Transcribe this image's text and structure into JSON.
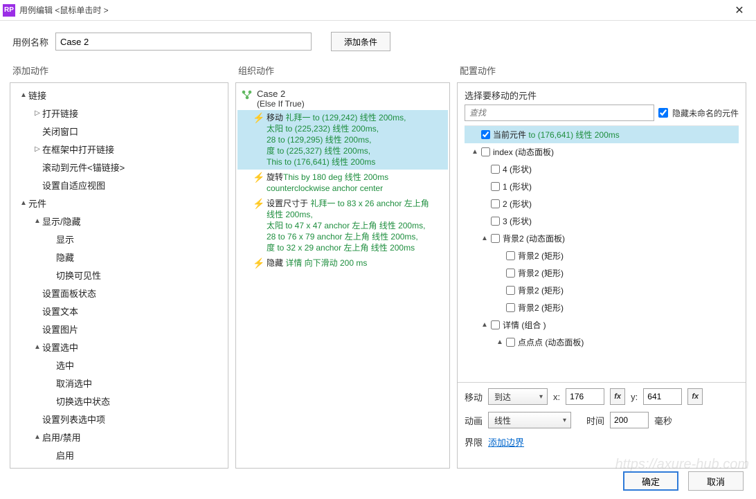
{
  "title": "用例编辑 <鼠标单击时 >",
  "case_name_label": "用例名称",
  "case_name_value": "Case 2",
  "add_condition_btn": "添加条件",
  "section_headers": {
    "add_action": "添加动作",
    "organize_action": "组织动作",
    "configure_action": "配置动作"
  },
  "left_tree": [
    {
      "indent": 1,
      "toggle": "▲",
      "label": "链接"
    },
    {
      "indent": 2,
      "toggle": "▷",
      "label": "打开链接"
    },
    {
      "indent": 2,
      "toggle": "",
      "label": "关闭窗口"
    },
    {
      "indent": 2,
      "toggle": "▷",
      "label": "在框架中打开链接"
    },
    {
      "indent": 2,
      "toggle": "",
      "label": "滚动到元件<锚链接>"
    },
    {
      "indent": 2,
      "toggle": "",
      "label": "设置自适应视图"
    },
    {
      "indent": 1,
      "toggle": "▲",
      "label": "元件"
    },
    {
      "indent": 2,
      "toggle": "▲",
      "label": "显示/隐藏"
    },
    {
      "indent": 3,
      "toggle": "",
      "label": "显示"
    },
    {
      "indent": 3,
      "toggle": "",
      "label": "隐藏"
    },
    {
      "indent": 3,
      "toggle": "",
      "label": "切换可见性"
    },
    {
      "indent": 2,
      "toggle": "",
      "label": "设置面板状态"
    },
    {
      "indent": 2,
      "toggle": "",
      "label": "设置文本"
    },
    {
      "indent": 2,
      "toggle": "",
      "label": "设置图片"
    },
    {
      "indent": 2,
      "toggle": "▲",
      "label": "设置选中"
    },
    {
      "indent": 3,
      "toggle": "",
      "label": "选中"
    },
    {
      "indent": 3,
      "toggle": "",
      "label": "取消选中"
    },
    {
      "indent": 3,
      "toggle": "",
      "label": "切换选中状态"
    },
    {
      "indent": 2,
      "toggle": "",
      "label": "设置列表选中项"
    },
    {
      "indent": 2,
      "toggle": "▲",
      "label": "启用/禁用"
    },
    {
      "indent": 3,
      "toggle": "",
      "label": "启用"
    }
  ],
  "case": {
    "title": "Case 2",
    "subtitle": "(Else If True)"
  },
  "actions": [
    {
      "selected": true,
      "lines": [
        [
          {
            "t": "移动 ",
            "c": "black"
          },
          {
            "t": "礼拜一 to (129,242) 线性 200ms,",
            "c": "green"
          }
        ],
        [
          {
            "t": "太阳 to (225,232) 线性 200ms,",
            "c": "green"
          }
        ],
        [
          {
            "t": "28 to (129,295) 线性 200ms,",
            "c": "green"
          }
        ],
        [
          {
            "t": "度 to (225,327) 线性 200ms,",
            "c": "green"
          }
        ],
        [
          {
            "t": "This to (176,641) 线性 200ms",
            "c": "green"
          }
        ]
      ]
    },
    {
      "selected": false,
      "lines": [
        [
          {
            "t": "旋转",
            "c": "black"
          },
          {
            "t": "This by 180 deg 线性 200ms",
            "c": "green"
          }
        ],
        [
          {
            "t": "counterclockwise anchor center",
            "c": "green"
          }
        ]
      ]
    },
    {
      "selected": false,
      "lines": [
        [
          {
            "t": "设置尺寸于 ",
            "c": "black"
          },
          {
            "t": "礼拜一 to 83 x 26 anchor 左上角",
            "c": "green"
          }
        ],
        [
          {
            "t": "线性 200ms,",
            "c": "green"
          }
        ],
        [
          {
            "t": "太阳 to 47 x 47 anchor 左上角 线性 200ms,",
            "c": "green"
          }
        ],
        [
          {
            "t": "28 to 76 x 79 anchor 左上角 线性 200ms,",
            "c": "green"
          }
        ],
        [
          {
            "t": "度 to 32 x 29 anchor 左上角 线性 200ms",
            "c": "green"
          }
        ]
      ]
    },
    {
      "selected": false,
      "lines": [
        [
          {
            "t": "隐藏 ",
            "c": "black"
          },
          {
            "t": "详情 向下滑动 200 ms",
            "c": "green"
          }
        ]
      ]
    }
  ],
  "config": {
    "select_elements_label": "选择要移动的元件",
    "search_placeholder": "查找",
    "hide_unnamed_label": "隐藏未命名的元件",
    "elements": [
      {
        "indent": 0,
        "toggle": "",
        "checked": true,
        "selected": true,
        "label": "当前元件",
        "suffix": "to (176,641) 线性 200ms"
      },
      {
        "indent": 0,
        "toggle": "▲",
        "checked": false,
        "label": "index (动态面板)"
      },
      {
        "indent": 1,
        "toggle": "",
        "checked": false,
        "label": "4 (形状)"
      },
      {
        "indent": 1,
        "toggle": "",
        "checked": false,
        "label": "1 (形状)"
      },
      {
        "indent": 1,
        "toggle": "",
        "checked": false,
        "label": "2 (形状)"
      },
      {
        "indent": 1,
        "toggle": "",
        "checked": false,
        "label": "3 (形状)"
      },
      {
        "indent": 1,
        "toggle": "▲",
        "checked": false,
        "label": "背景2 (动态面板)"
      },
      {
        "indent": 2,
        "toggle": "",
        "checked": false,
        "label": "背景2 (矩形)"
      },
      {
        "indent": 2,
        "toggle": "",
        "checked": false,
        "label": "背景2 (矩形)"
      },
      {
        "indent": 2,
        "toggle": "",
        "checked": false,
        "label": "背景2 (矩形)"
      },
      {
        "indent": 2,
        "toggle": "",
        "checked": false,
        "label": "背景2 (矩形)"
      },
      {
        "indent": 1,
        "toggle": "▲",
        "checked": false,
        "label": "详情 (组合 )"
      },
      {
        "indent": 2,
        "toggle": "▲",
        "checked": false,
        "label": "点点点 (动态面板)"
      }
    ],
    "move_label": "移动",
    "move_mode": "到达",
    "x_label": "x:",
    "x_value": "176",
    "y_label": "y:",
    "y_value": "641",
    "fx_label": "fx",
    "anim_label": "动画",
    "anim_mode": "线性",
    "time_label": "时间",
    "time_value": "200",
    "time_unit": "毫秒",
    "bounds_label": "界限",
    "add_boundary_link": "添加边界"
  },
  "footer": {
    "ok": "确定",
    "cancel": "取消"
  },
  "watermark": "https://axure-hub.com"
}
